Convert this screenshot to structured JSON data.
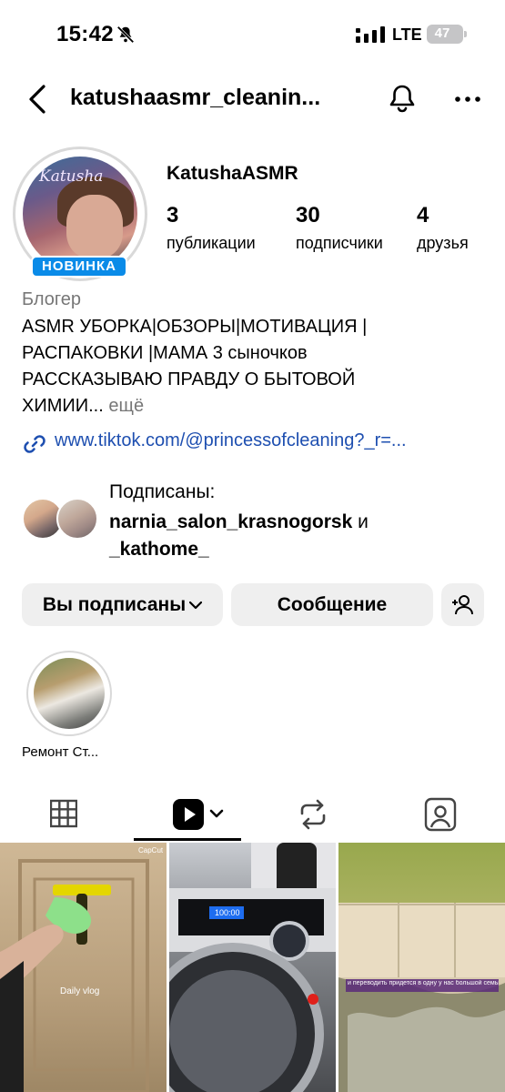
{
  "status_bar": {
    "time": "15:42",
    "network": "LTE",
    "battery": "47"
  },
  "header": {
    "username": "katushaasmr_cleanin...",
    "icons": [
      "back-icon",
      "bell-icon",
      "more-icon"
    ]
  },
  "profile": {
    "display_name": "KatushaASMR",
    "avatar_logo": "Katusha",
    "badge": "НОВИНКА",
    "stats": [
      {
        "value": "3",
        "label": "публикации"
      },
      {
        "value": "30",
        "label": "подписчики"
      },
      {
        "value": "4",
        "label": "друзья"
      }
    ],
    "category": "Блогер",
    "bio_lines": [
      "ASMR УБОРКА|ОБЗОРЫ|МОТИВАЦИЯ |",
      "РАСПАКОВКИ |МАМА 3 сыночков",
      "РАССКАЗЫВАЮ ПРАВДУ О БЫТОВОЙ",
      "ХИМИИ..."
    ],
    "bio_more": "ещё",
    "link": "www.tiktok.com/@princessofcleaning?_r=..."
  },
  "followed_by": {
    "title": "Подписаны:",
    "name_1": "narnia_salon_krasnogorsk",
    "conjunction": "и",
    "name_2": "_kathome_"
  },
  "actions": {
    "following_label": "Вы подписаны",
    "message_label": "Сообщение"
  },
  "highlights": [
    {
      "label": "Ремонт Ст..."
    }
  ],
  "tabs": [
    "grid-icon",
    "reels-icon",
    "repost-icon",
    "tagged-icon"
  ],
  "posts": [
    {
      "caption": "Daily vlog",
      "watermark": "CapCut"
    },
    {
      "display_readout": "100:00"
    },
    {
      "caption": "и переводить придется в одну у нас большой семьи"
    }
  ],
  "colors": {
    "badge": "#0a8be8",
    "link": "#1e4fb0",
    "button_bg": "#efefef"
  }
}
